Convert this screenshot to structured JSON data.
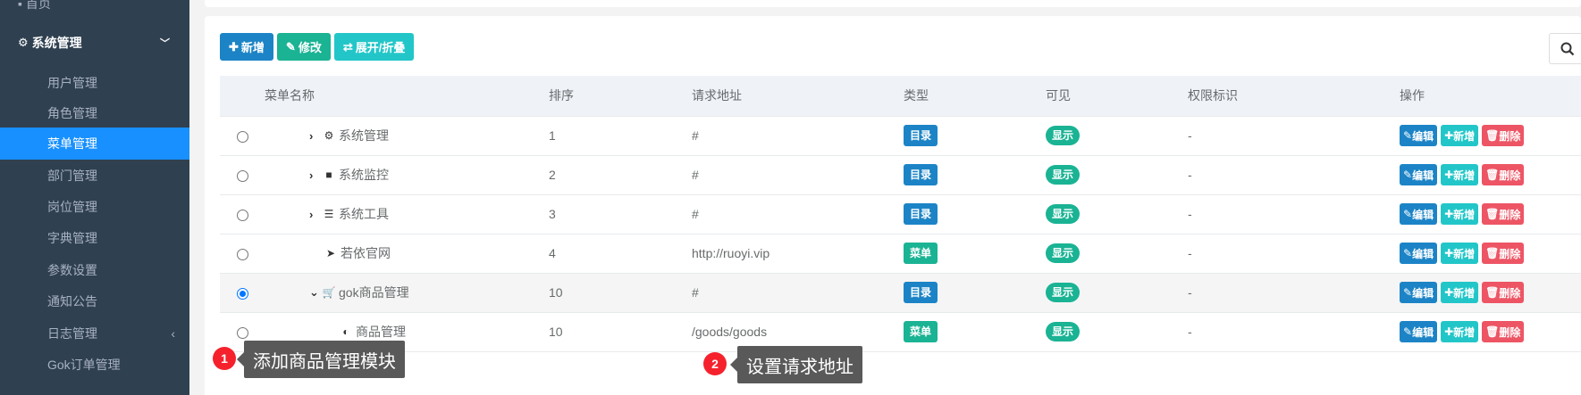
{
  "sidebar": {
    "top_item": "首页",
    "group": {
      "label": "系统管理",
      "icon": "gear-icon"
    },
    "items": [
      {
        "label": "用户管理"
      },
      {
        "label": "角色管理"
      },
      {
        "label": "菜单管理",
        "active": true
      },
      {
        "label": "部门管理"
      },
      {
        "label": "岗位管理"
      },
      {
        "label": "字典管理"
      },
      {
        "label": "参数设置"
      },
      {
        "label": "通知公告"
      },
      {
        "label": "日志管理",
        "has_children": true
      },
      {
        "label": "Gok订单管理"
      }
    ]
  },
  "toolbar": {
    "add_label": "新增",
    "edit_label": "修改",
    "toggle_label": "展开/折叠"
  },
  "table": {
    "headers": [
      "菜单名称",
      "排序",
      "请求地址",
      "类型",
      "可见",
      "权限标识",
      "操作"
    ],
    "rows": [
      {
        "name": "系统管理",
        "icon": "gear-icon",
        "arrow": "right",
        "order": "1",
        "url": "#",
        "type": "目录",
        "visible": "显示",
        "perm": "-",
        "selected": false
      },
      {
        "name": "系统监控",
        "icon": "video-camera-icon",
        "arrow": "right",
        "order": "2",
        "url": "#",
        "type": "目录",
        "visible": "显示",
        "perm": "-",
        "selected": false
      },
      {
        "name": "系统工具",
        "icon": "bars-icon",
        "arrow": "right",
        "order": "3",
        "url": "#",
        "type": "目录",
        "visible": "显示",
        "perm": "-",
        "selected": false
      },
      {
        "name": "若依官网",
        "icon": "location-arrow-icon",
        "arrow": "none",
        "order": "4",
        "url": "http://ruoyi.vip",
        "type": "菜单",
        "visible": "显示",
        "perm": "-",
        "selected": false
      },
      {
        "name": "gok商品管理",
        "icon": "cart-icon",
        "arrow": "down",
        "order": "10",
        "url": "#",
        "type": "目录",
        "visible": "显示",
        "perm": "-",
        "selected": true
      },
      {
        "name": "商品管理",
        "icon": "half-circle-icon",
        "arrow": "none",
        "order": "10",
        "url": "/goods/goods",
        "type": "菜单",
        "visible": "显示",
        "perm": "-",
        "selected": false
      }
    ],
    "ops": {
      "edit": "编辑",
      "add": "新增",
      "del": "删除"
    }
  },
  "annotations": [
    {
      "num": "1",
      "text": "添加商品管理模块"
    },
    {
      "num": "2",
      "text": "设置请求地址"
    }
  ],
  "colors": {
    "sidebar_bg": "#2f4050",
    "active": "#1890ff",
    "primary": "#1c84c6",
    "success": "#1ab394",
    "info": "#23c6c8",
    "danger": "#ed5565",
    "badge": "#f5222d"
  }
}
